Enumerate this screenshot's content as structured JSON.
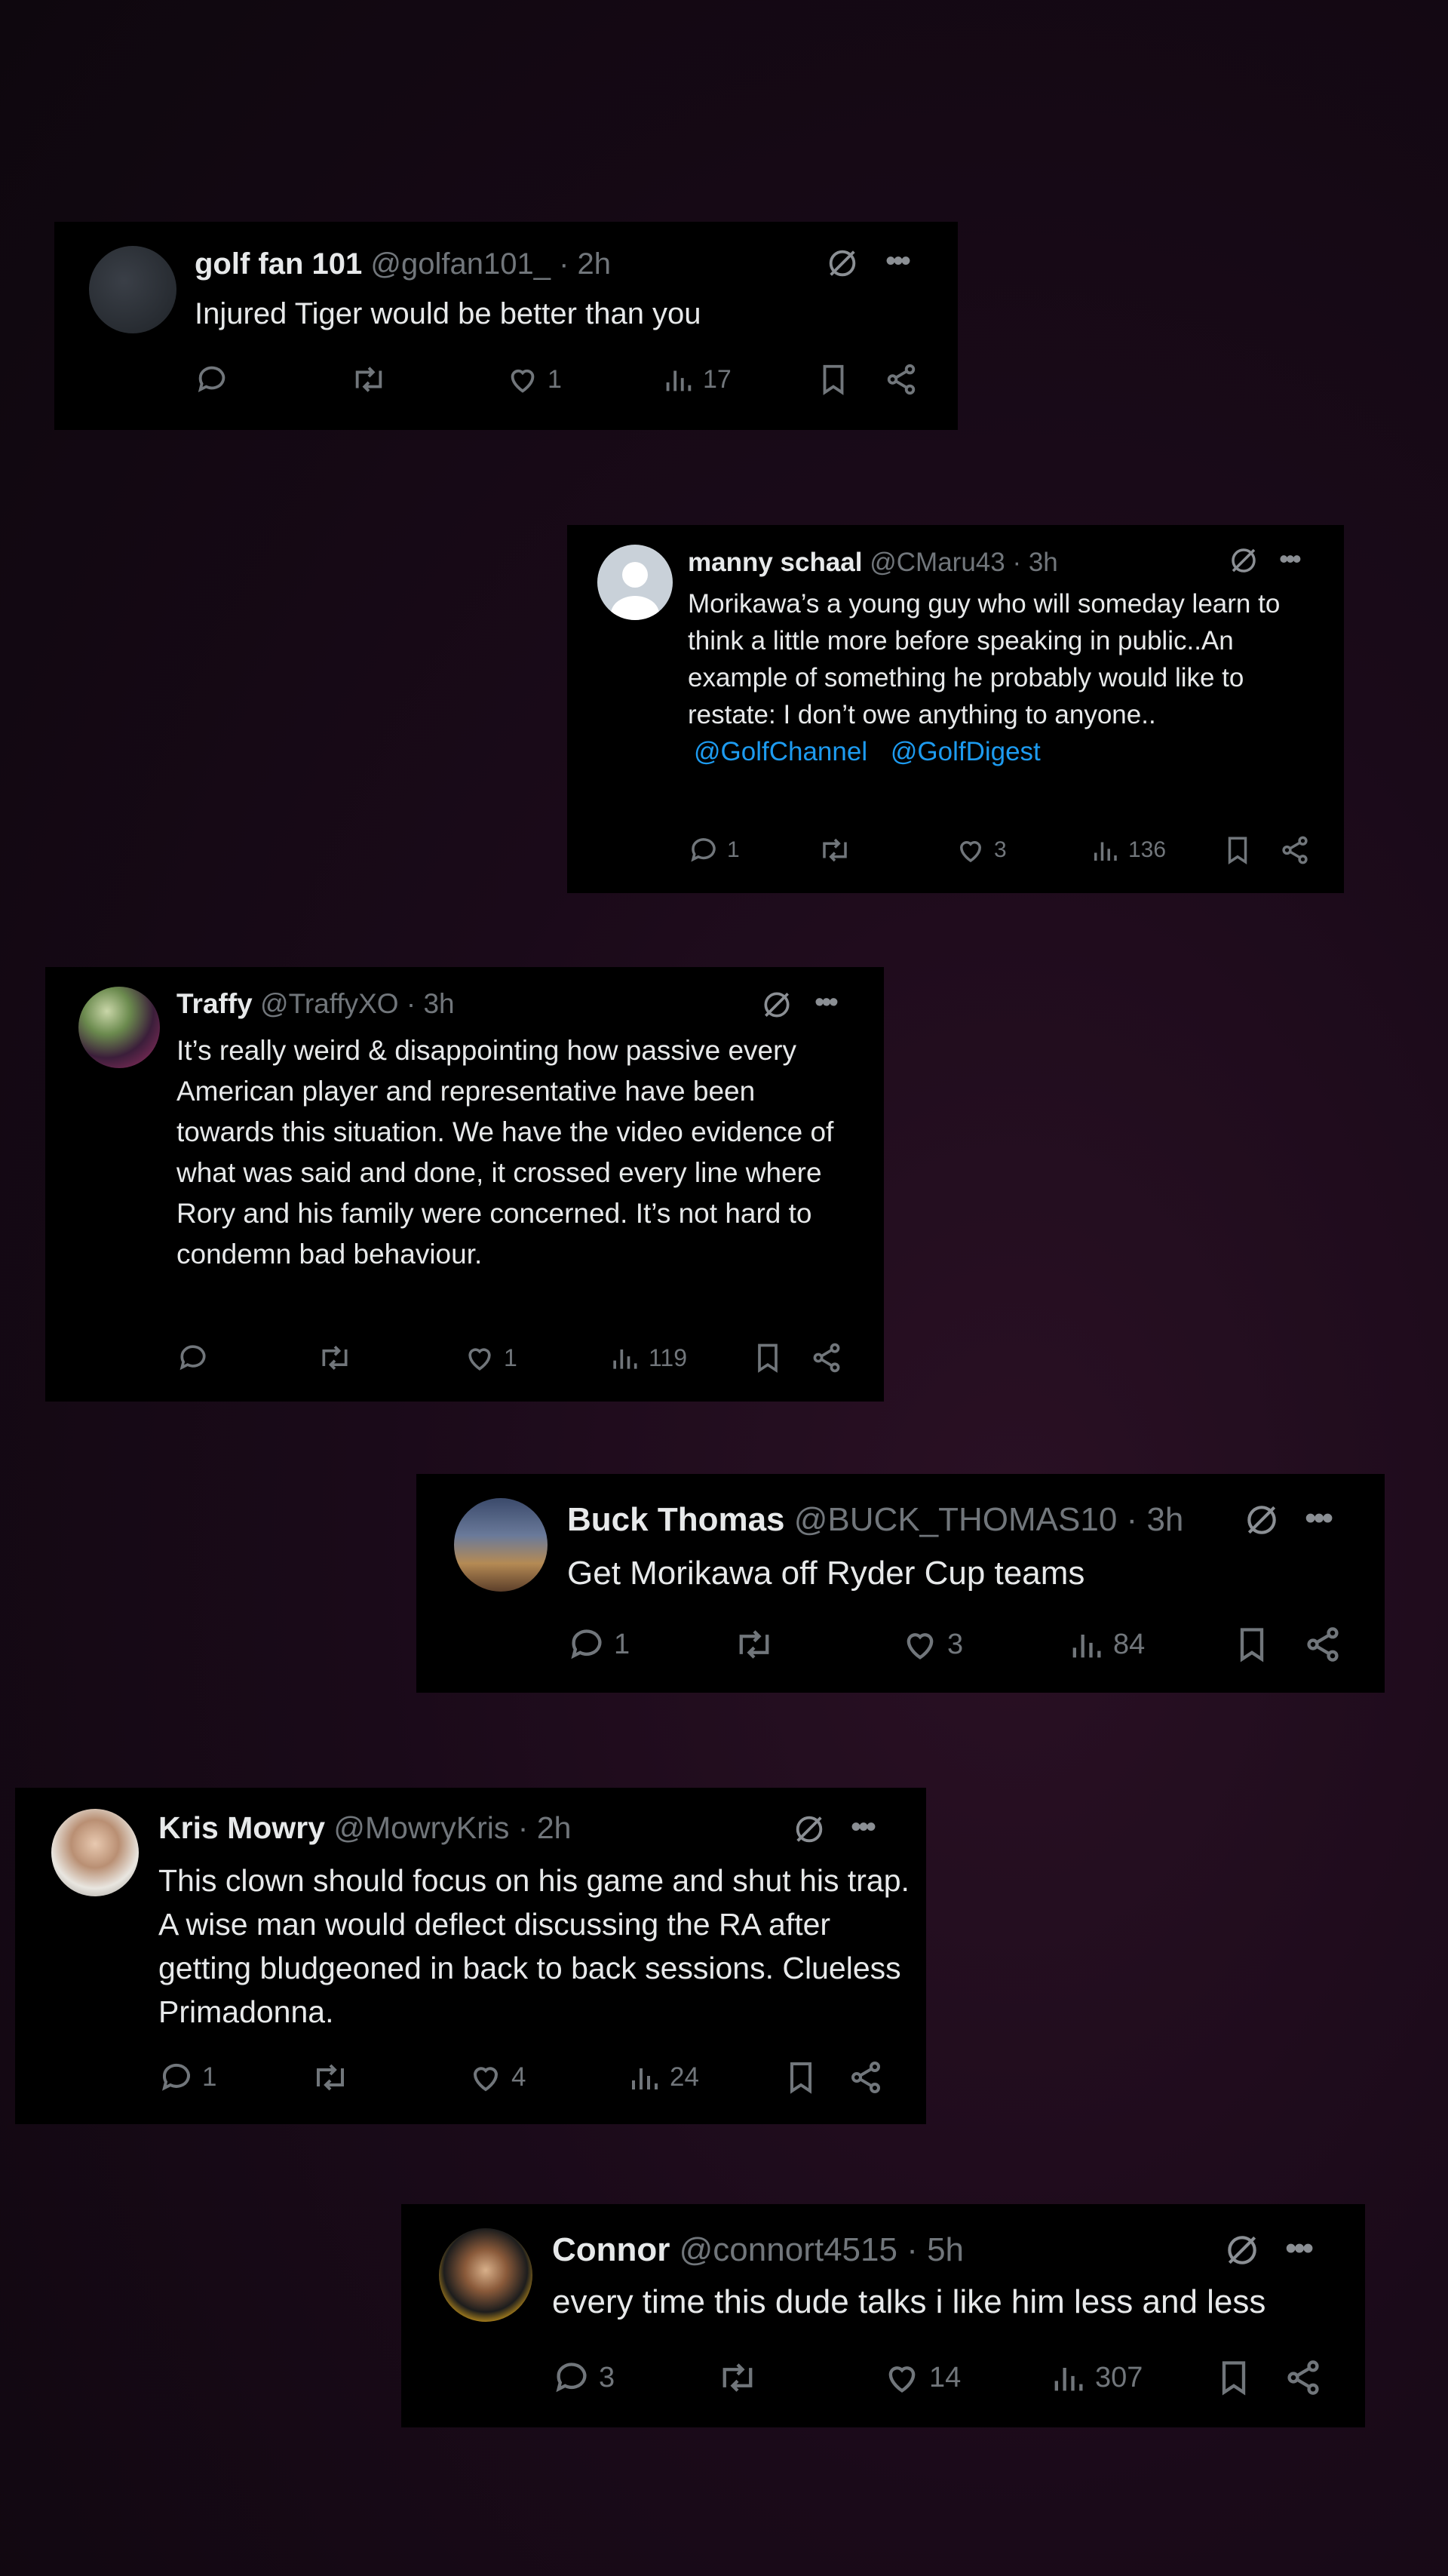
{
  "tweets": [
    {
      "name": "golf fan 101",
      "handle": "@golfan101_",
      "time": "2h",
      "text": "Injured Tiger would be better than you",
      "mentions": [],
      "replies": "",
      "likes": "1",
      "views": "17"
    },
    {
      "name": "manny schaal",
      "handle": "@CMaru43",
      "time": "3h",
      "text": "Morikawa’s a young guy who will someday learn to think a little more before speaking in public..An example of something he probably would like to restate: I don’t owe anything to anyone..",
      "mentions": [
        "@GolfChannel",
        "@GolfDigest"
      ],
      "replies": "1",
      "likes": "3",
      "views": "136"
    },
    {
      "name": "Traffy",
      "handle": "@TraffyXO",
      "time": "3h",
      "text": "It’s really weird & disappointing how passive every American player and representative have been towards this situation. We have the video evidence of what was said and done, it crossed every line where Rory and his family were concerned. It’s not hard to condemn bad behaviour.",
      "mentions": [],
      "replies": "",
      "likes": "1",
      "views": "119"
    },
    {
      "name": "Buck Thomas",
      "handle": "@BUCK_THOMAS10",
      "time": "3h",
      "text": "Get Morikawa off Ryder Cup teams",
      "mentions": [],
      "replies": "1",
      "likes": "3",
      "views": "84"
    },
    {
      "name": "Kris Mowry",
      "handle": "@MowryKris",
      "time": "2h",
      "text": "This clown should focus on his game and shut his trap. A wise man would deflect discussing the RA after getting bludgeoned in back to back sessions. Clueless Primadonna.",
      "mentions": [],
      "replies": "1",
      "likes": "4",
      "views": "24"
    },
    {
      "name": "Connor",
      "handle": "@connort4515",
      "time": "5h",
      "text": "every time this dude talks i like him less and less",
      "mentions": [],
      "replies": "3",
      "likes": "14",
      "views": "307"
    }
  ]
}
